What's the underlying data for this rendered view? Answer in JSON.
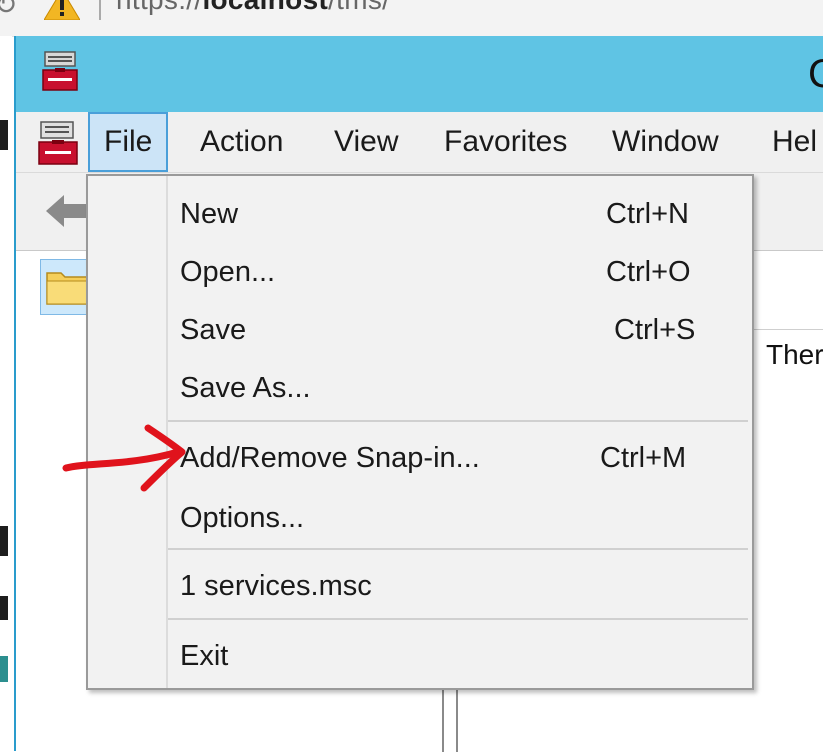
{
  "browser": {
    "url_prefix": "https://",
    "url_host": "localhost",
    "url_path": "/tms/"
  },
  "window": {
    "title_visible": "C",
    "accent_color": "#5fc4e4"
  },
  "menubar": {
    "items": [
      "File",
      "Action",
      "View",
      "Favorites",
      "Window",
      "Hel"
    ]
  },
  "file_menu": {
    "items": [
      {
        "label": "New",
        "shortcut": "Ctrl+N"
      },
      {
        "label": "Open...",
        "shortcut": "Ctrl+O"
      },
      {
        "label": "Save",
        "shortcut": "Ctrl+S"
      },
      {
        "label": "Save As...",
        "shortcut": ""
      },
      {
        "label": "Add/Remove Snap-in...",
        "shortcut": "Ctrl+M"
      },
      {
        "label": "Options...",
        "shortcut": ""
      },
      {
        "label": "1 services.msc",
        "shortcut": ""
      },
      {
        "label": "Exit",
        "shortcut": ""
      }
    ]
  },
  "content": {
    "right_text": "Ther"
  },
  "icons": {
    "app": "mmc-toolbox-icon",
    "back": "back-arrow-icon",
    "folder": "folder-icon",
    "warning": "warning-icon",
    "annotation": "red-arrow-annotation"
  },
  "annotation_color": "#e0131c"
}
